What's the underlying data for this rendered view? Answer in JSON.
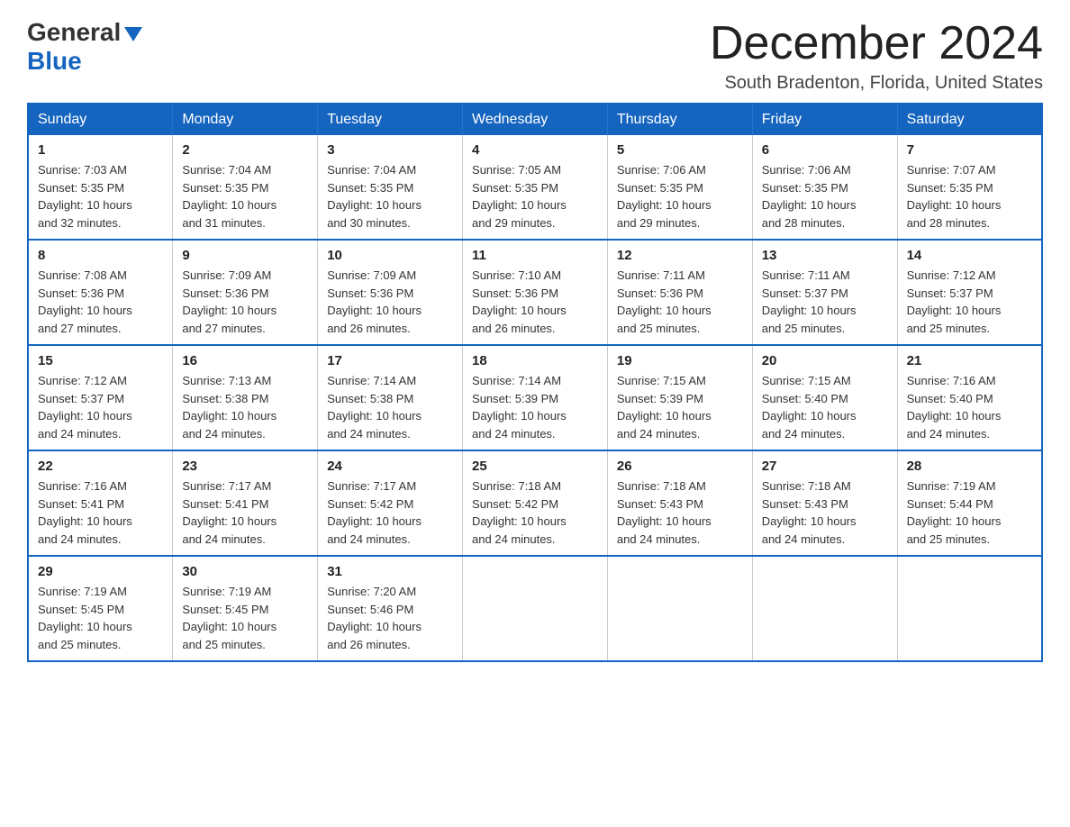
{
  "logo": {
    "general": "General",
    "blue": "Blue"
  },
  "header": {
    "month": "December 2024",
    "location": "South Bradenton, Florida, United States"
  },
  "weekdays": [
    "Sunday",
    "Monday",
    "Tuesday",
    "Wednesday",
    "Thursday",
    "Friday",
    "Saturday"
  ],
  "weeks": [
    [
      {
        "day": "1",
        "sunrise": "7:03 AM",
        "sunset": "5:35 PM",
        "daylight": "10 hours and 32 minutes."
      },
      {
        "day": "2",
        "sunrise": "7:04 AM",
        "sunset": "5:35 PM",
        "daylight": "10 hours and 31 minutes."
      },
      {
        "day": "3",
        "sunrise": "7:04 AM",
        "sunset": "5:35 PM",
        "daylight": "10 hours and 30 minutes."
      },
      {
        "day": "4",
        "sunrise": "7:05 AM",
        "sunset": "5:35 PM",
        "daylight": "10 hours and 29 minutes."
      },
      {
        "day": "5",
        "sunrise": "7:06 AM",
        "sunset": "5:35 PM",
        "daylight": "10 hours and 29 minutes."
      },
      {
        "day": "6",
        "sunrise": "7:06 AM",
        "sunset": "5:35 PM",
        "daylight": "10 hours and 28 minutes."
      },
      {
        "day": "7",
        "sunrise": "7:07 AM",
        "sunset": "5:35 PM",
        "daylight": "10 hours and 28 minutes."
      }
    ],
    [
      {
        "day": "8",
        "sunrise": "7:08 AM",
        "sunset": "5:36 PM",
        "daylight": "10 hours and 27 minutes."
      },
      {
        "day": "9",
        "sunrise": "7:09 AM",
        "sunset": "5:36 PM",
        "daylight": "10 hours and 27 minutes."
      },
      {
        "day": "10",
        "sunrise": "7:09 AM",
        "sunset": "5:36 PM",
        "daylight": "10 hours and 26 minutes."
      },
      {
        "day": "11",
        "sunrise": "7:10 AM",
        "sunset": "5:36 PM",
        "daylight": "10 hours and 26 minutes."
      },
      {
        "day": "12",
        "sunrise": "7:11 AM",
        "sunset": "5:36 PM",
        "daylight": "10 hours and 25 minutes."
      },
      {
        "day": "13",
        "sunrise": "7:11 AM",
        "sunset": "5:37 PM",
        "daylight": "10 hours and 25 minutes."
      },
      {
        "day": "14",
        "sunrise": "7:12 AM",
        "sunset": "5:37 PM",
        "daylight": "10 hours and 25 minutes."
      }
    ],
    [
      {
        "day": "15",
        "sunrise": "7:12 AM",
        "sunset": "5:37 PM",
        "daylight": "10 hours and 24 minutes."
      },
      {
        "day": "16",
        "sunrise": "7:13 AM",
        "sunset": "5:38 PM",
        "daylight": "10 hours and 24 minutes."
      },
      {
        "day": "17",
        "sunrise": "7:14 AM",
        "sunset": "5:38 PM",
        "daylight": "10 hours and 24 minutes."
      },
      {
        "day": "18",
        "sunrise": "7:14 AM",
        "sunset": "5:39 PM",
        "daylight": "10 hours and 24 minutes."
      },
      {
        "day": "19",
        "sunrise": "7:15 AM",
        "sunset": "5:39 PM",
        "daylight": "10 hours and 24 minutes."
      },
      {
        "day": "20",
        "sunrise": "7:15 AM",
        "sunset": "5:40 PM",
        "daylight": "10 hours and 24 minutes."
      },
      {
        "day": "21",
        "sunrise": "7:16 AM",
        "sunset": "5:40 PM",
        "daylight": "10 hours and 24 minutes."
      }
    ],
    [
      {
        "day": "22",
        "sunrise": "7:16 AM",
        "sunset": "5:41 PM",
        "daylight": "10 hours and 24 minutes."
      },
      {
        "day": "23",
        "sunrise": "7:17 AM",
        "sunset": "5:41 PM",
        "daylight": "10 hours and 24 minutes."
      },
      {
        "day": "24",
        "sunrise": "7:17 AM",
        "sunset": "5:42 PM",
        "daylight": "10 hours and 24 minutes."
      },
      {
        "day": "25",
        "sunrise": "7:18 AM",
        "sunset": "5:42 PM",
        "daylight": "10 hours and 24 minutes."
      },
      {
        "day": "26",
        "sunrise": "7:18 AM",
        "sunset": "5:43 PM",
        "daylight": "10 hours and 24 minutes."
      },
      {
        "day": "27",
        "sunrise": "7:18 AM",
        "sunset": "5:43 PM",
        "daylight": "10 hours and 24 minutes."
      },
      {
        "day": "28",
        "sunrise": "7:19 AM",
        "sunset": "5:44 PM",
        "daylight": "10 hours and 25 minutes."
      }
    ],
    [
      {
        "day": "29",
        "sunrise": "7:19 AM",
        "sunset": "5:45 PM",
        "daylight": "10 hours and 25 minutes."
      },
      {
        "day": "30",
        "sunrise": "7:19 AM",
        "sunset": "5:45 PM",
        "daylight": "10 hours and 25 minutes."
      },
      {
        "day": "31",
        "sunrise": "7:20 AM",
        "sunset": "5:46 PM",
        "daylight": "10 hours and 26 minutes."
      },
      null,
      null,
      null,
      null
    ]
  ],
  "labels": {
    "sunrise": "Sunrise:",
    "sunset": "Sunset:",
    "daylight": "Daylight:"
  }
}
